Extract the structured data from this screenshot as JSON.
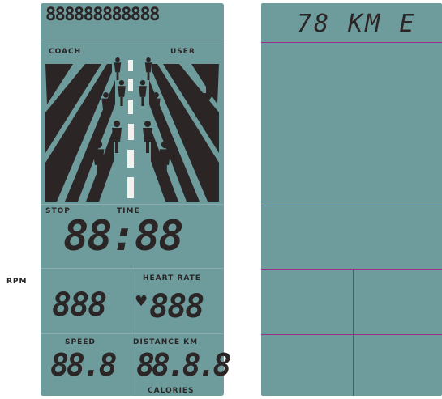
{
  "side_label": "RPM",
  "left_display": {
    "top_row_chars": "888888888888",
    "coach_label": "COACH",
    "user_label": "USER",
    "stop_label": "STOP",
    "time_label": "TIME",
    "time_value": "88:88",
    "rpm_value": "888",
    "heart_rate_label": "HEART RATE",
    "heart_rate_value": "888",
    "speed_label": "SPEED",
    "speed_value": "88.8",
    "distance_label": "DISTANCE  KM",
    "distance_value": "88.8.8",
    "calories_label": "CALORIES"
  },
  "right_display": {
    "top_text": "78 KM E"
  },
  "colors": {
    "lcd_background": "#6e9b9c",
    "segment": "#2b2525",
    "divider_magenta": "#9a2f8c"
  }
}
